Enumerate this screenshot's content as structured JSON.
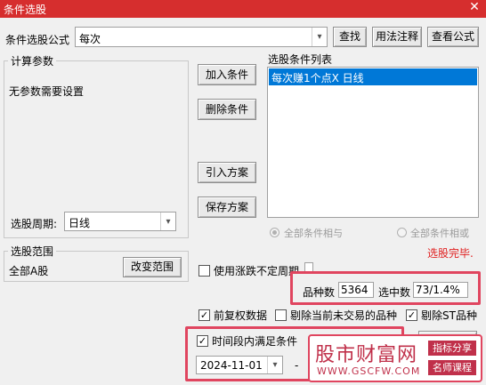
{
  "window": {
    "title": "条件选股",
    "close_glyph": "✕"
  },
  "formula": {
    "label": "条件选股公式",
    "value": "每次",
    "arrow": "▾"
  },
  "toolbar": {
    "find": "查找",
    "usage": "用法注释",
    "view": "查看公式"
  },
  "params": {
    "group_title": "计算参数",
    "message": "无参数需要设置"
  },
  "period": {
    "label": "选股周期:",
    "value": "日线",
    "arrow": "▾"
  },
  "condition_buttons": {
    "add": "加入条件",
    "delete": "删除条件",
    "import": "引入方案",
    "save": "保存方案"
  },
  "condition_list": {
    "label": "选股条件列表",
    "items": [
      "每次赚1个点X  日线"
    ]
  },
  "logic": {
    "and_label": "全部条件相与",
    "or_label": "全部条件相或"
  },
  "status": {
    "text": "选股完毕.",
    "color": "#e02020"
  },
  "scope": {
    "group_title": "选股范围",
    "value": "全部A股",
    "change_button": "改变范围"
  },
  "options": {
    "use_uncertain": "使用涨跌不定周期",
    "fq": "前复权数据",
    "exclude_untraded": "剔除当前未交易的品种",
    "exclude_st": "剔除ST品种",
    "time_range": "时间段内满足条件"
  },
  "counts": {
    "total_label": "品种数",
    "total_value": "5364",
    "selected_label": "选中数",
    "selected_value": "73/1.4%"
  },
  "date": {
    "value": "2024-11-01",
    "dash": "-",
    "arrow": "▾"
  },
  "watermark": {
    "title": "股市财富网",
    "url": "WWW.GSCFW.COM",
    "tag1": "指标分享",
    "tag2": "名师课程"
  },
  "colors": {
    "title_bar": "#d62e2e",
    "highlight": "#0078d7",
    "annotation": "#e0455f",
    "watermark": "#c0304a"
  }
}
